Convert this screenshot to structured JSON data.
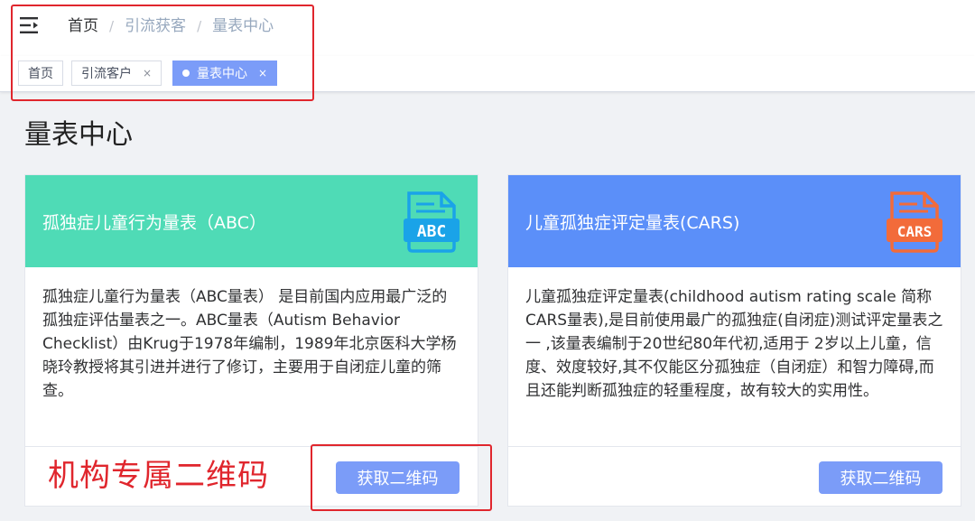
{
  "breadcrumb": {
    "items": [
      "首页",
      "引流获客",
      "量表中心"
    ],
    "separator": "/"
  },
  "tags": [
    {
      "label": "首页",
      "closable": false,
      "active": false
    },
    {
      "label": "引流客户",
      "closable": true,
      "active": false
    },
    {
      "label": "量表中心",
      "closable": true,
      "active": true
    }
  ],
  "tag_close_glyph": "×",
  "page_title": "量表中心",
  "cards": [
    {
      "title": "孤独症儿童行为量表（ABC）",
      "icon_text": "ABC",
      "icon": "abc-document-icon",
      "header_color": "#4fdbb6",
      "icon_color": "#1aa3e8",
      "description": "孤独症儿童行为量表（ABC量表） 是目前国内应用最广泛的孤独症评估量表之一。ABC量表（Autism Behavior Checklist）由Krug于1978年编制，1989年北京医科大学杨晓玲教授将其引进并进行了修订，主要用于自闭症儿童的筛查。",
      "button_label": "获取二维码"
    },
    {
      "title": "儿童孤独症评定量表(CARS)",
      "icon_text": "CARS",
      "icon": "cars-document-icon",
      "header_color": "#5b8ff9",
      "icon_color": "#f26b3a",
      "description": "儿童孤独症评定量表(childhood autism rating scale 简称CARS量表),是目前使用最广的孤独症(自闭症)测试评定量表之一 ,该量表编制于20世纪80年代初,适用于 2岁以上儿童，信度、效度较好,其不仅能区分孤独症（自闭症）和智力障碍,而且还能判断孤独症的轻重程度，故有较大的实用性。",
      "button_label": "获取二维码"
    }
  ],
  "annotation": "机构专属二维码",
  "colors": {
    "accent": "#7b9cf8",
    "annotation_red": "#e0262d"
  }
}
